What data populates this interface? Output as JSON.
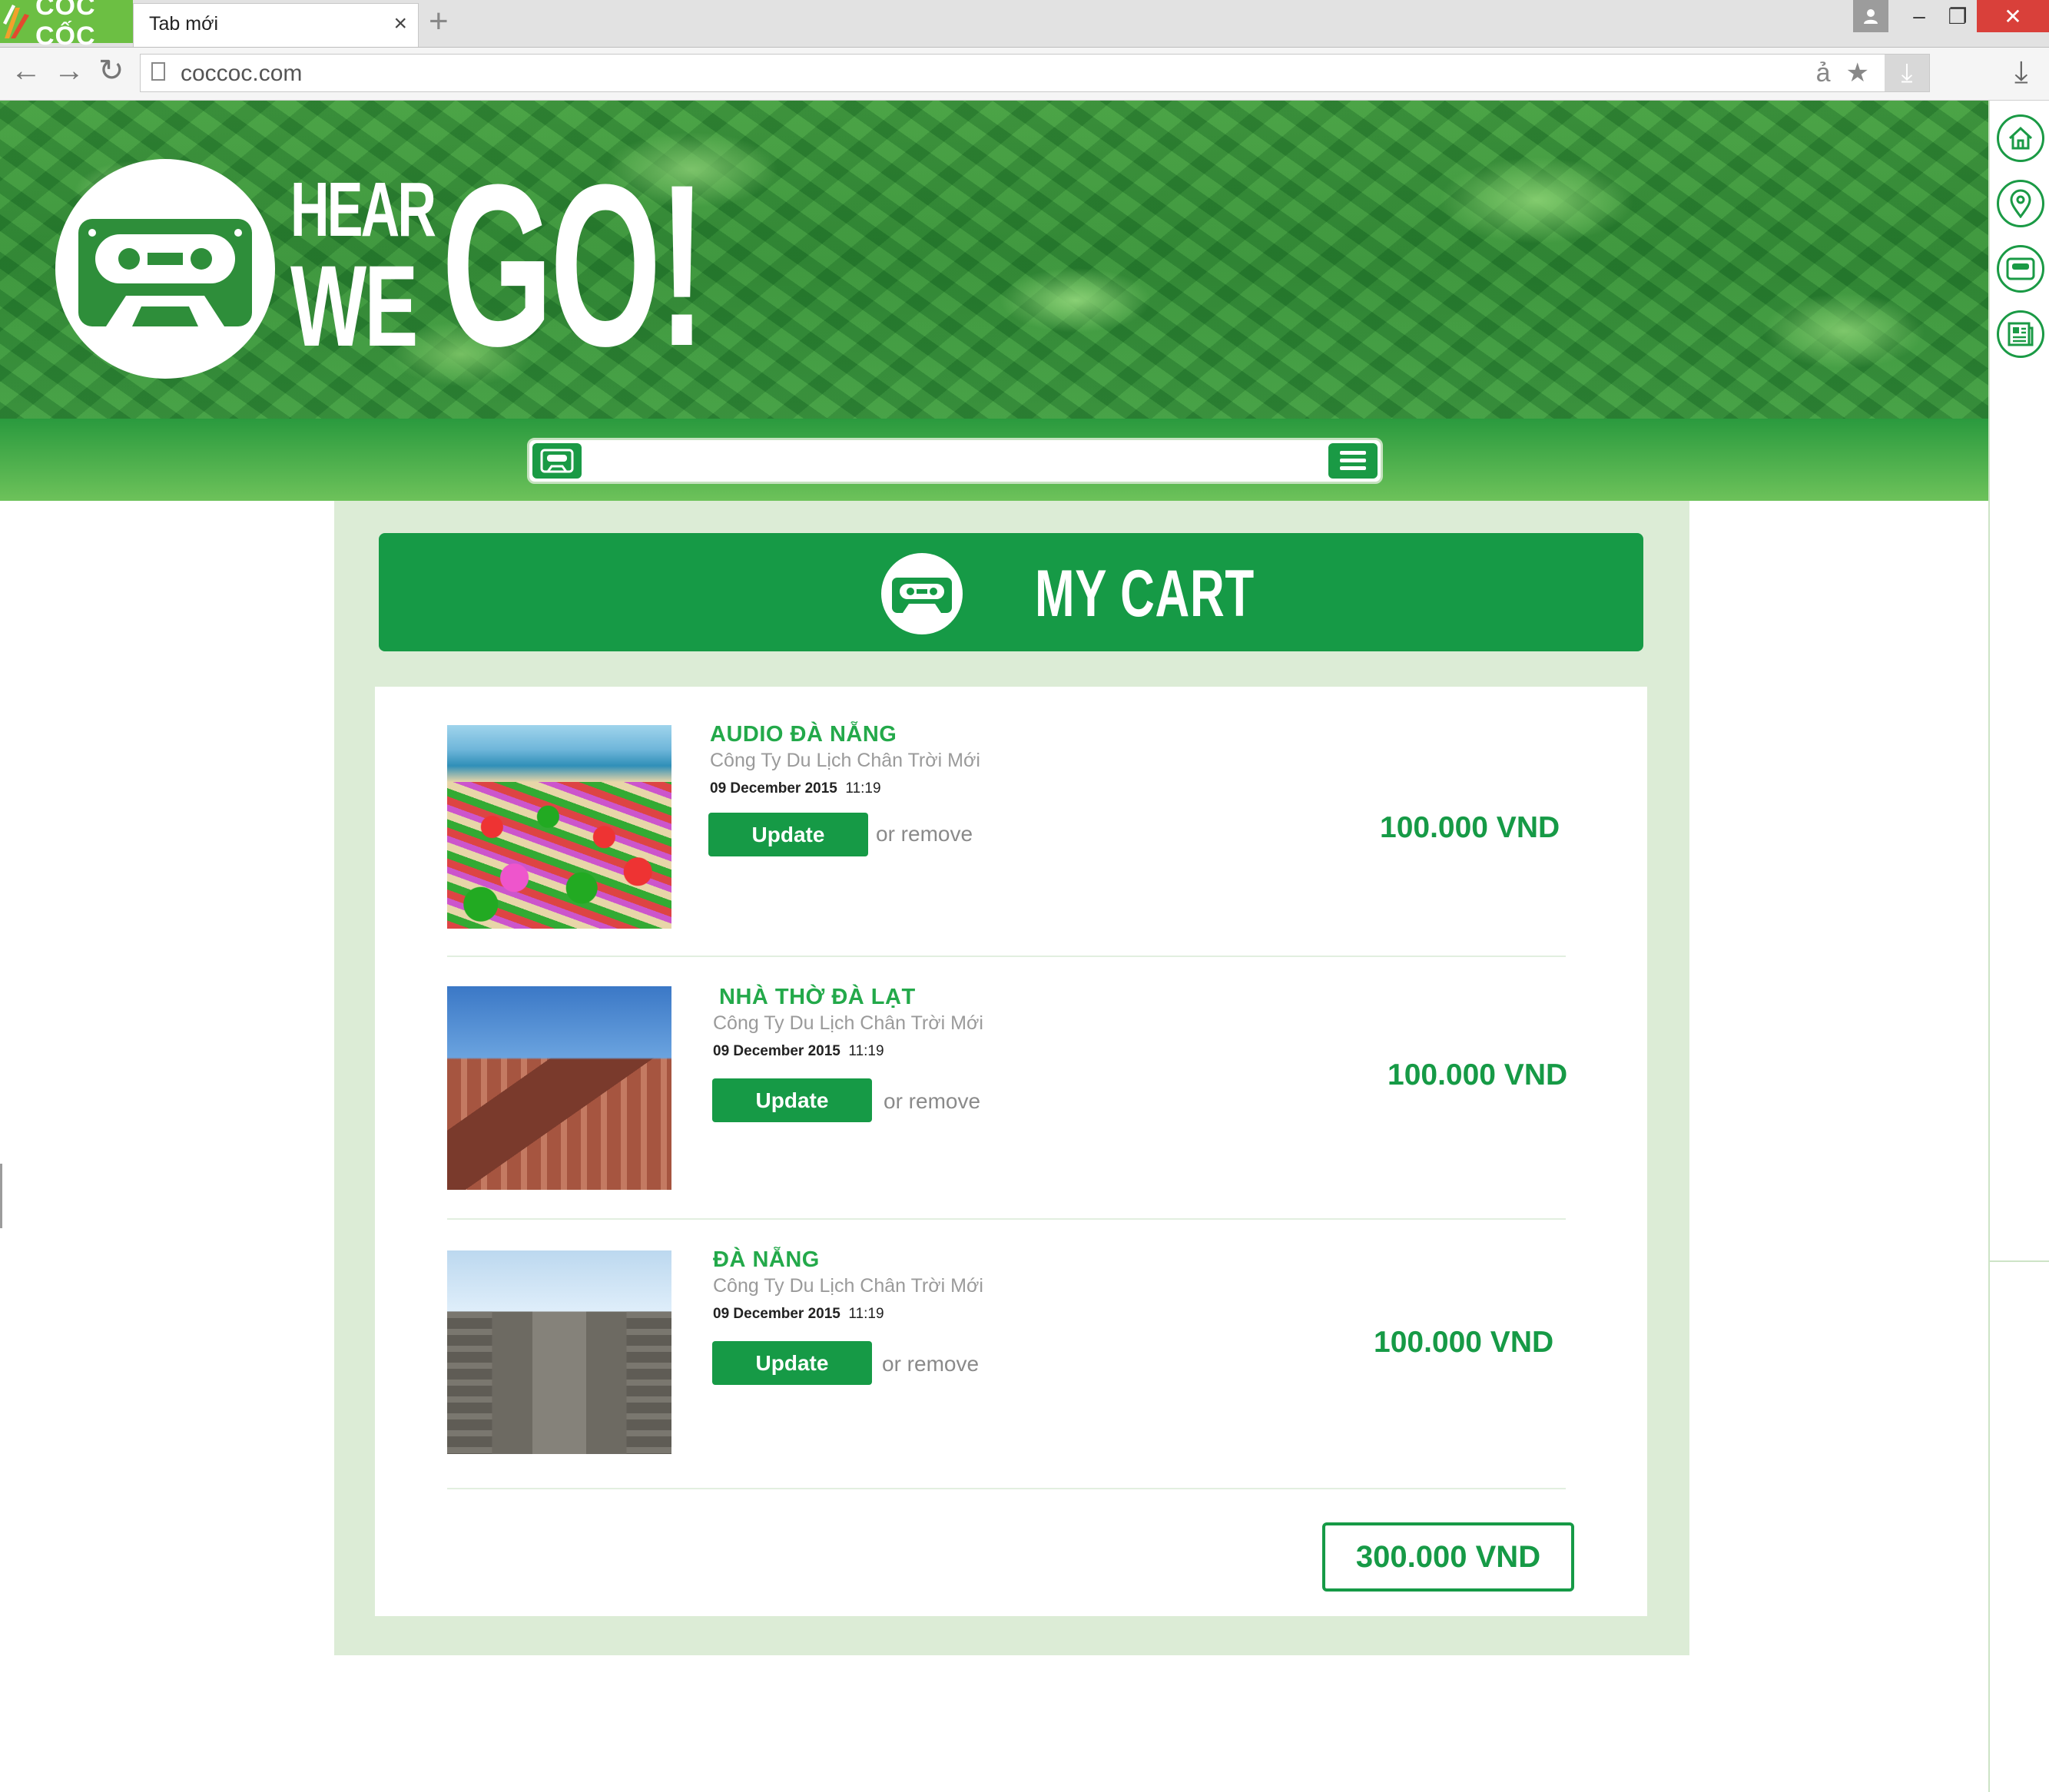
{
  "browser": {
    "brand": "CỐC CỐC",
    "tab_title": "Tab mới",
    "tab_close": "×",
    "new_tab": "+",
    "url": "coccoc.com",
    "controls": {
      "minimize": "–",
      "maximize": "❐",
      "close": "✕",
      "user": "👤"
    },
    "nav": {
      "back": "←",
      "forward": "→",
      "reload": "↻"
    }
  },
  "site": {
    "logo_hear": "HEAR",
    "logo_we": "WE",
    "logo_go": "GO!",
    "search_placeholder": ""
  },
  "cart": {
    "title": "MY CART",
    "items": [
      {
        "title": "AUDIO ĐÀ NẴNG",
        "company": "Công Ty Du Lịch Chân Trời Mới",
        "date": "09 December 2015",
        "time": "11:19",
        "update_label": "Update",
        "remove_label": "or remove",
        "price": "100.000 VND"
      },
      {
        "title": "NHÀ THỜ ĐÀ LẠT",
        "company": "Công Ty Du Lịch Chân Trời Mới",
        "date": "09 December 2015",
        "time": "11:19",
        "update_label": "Update",
        "remove_label": "or remove",
        "price": "100.000 VND"
      },
      {
        "title": "ĐÀ NẴNG",
        "company": "Công Ty Du Lịch Chân Trời Mới",
        "date": "09 December 2015",
        "time": "11:19",
        "update_label": "Update",
        "remove_label": "or remove",
        "price": "100.000 VND"
      }
    ],
    "total": "300.000 VND"
  },
  "colors": {
    "brand_green": "#169a46",
    "title_green": "#23a94a",
    "panel_bg": "#dcecd6"
  }
}
